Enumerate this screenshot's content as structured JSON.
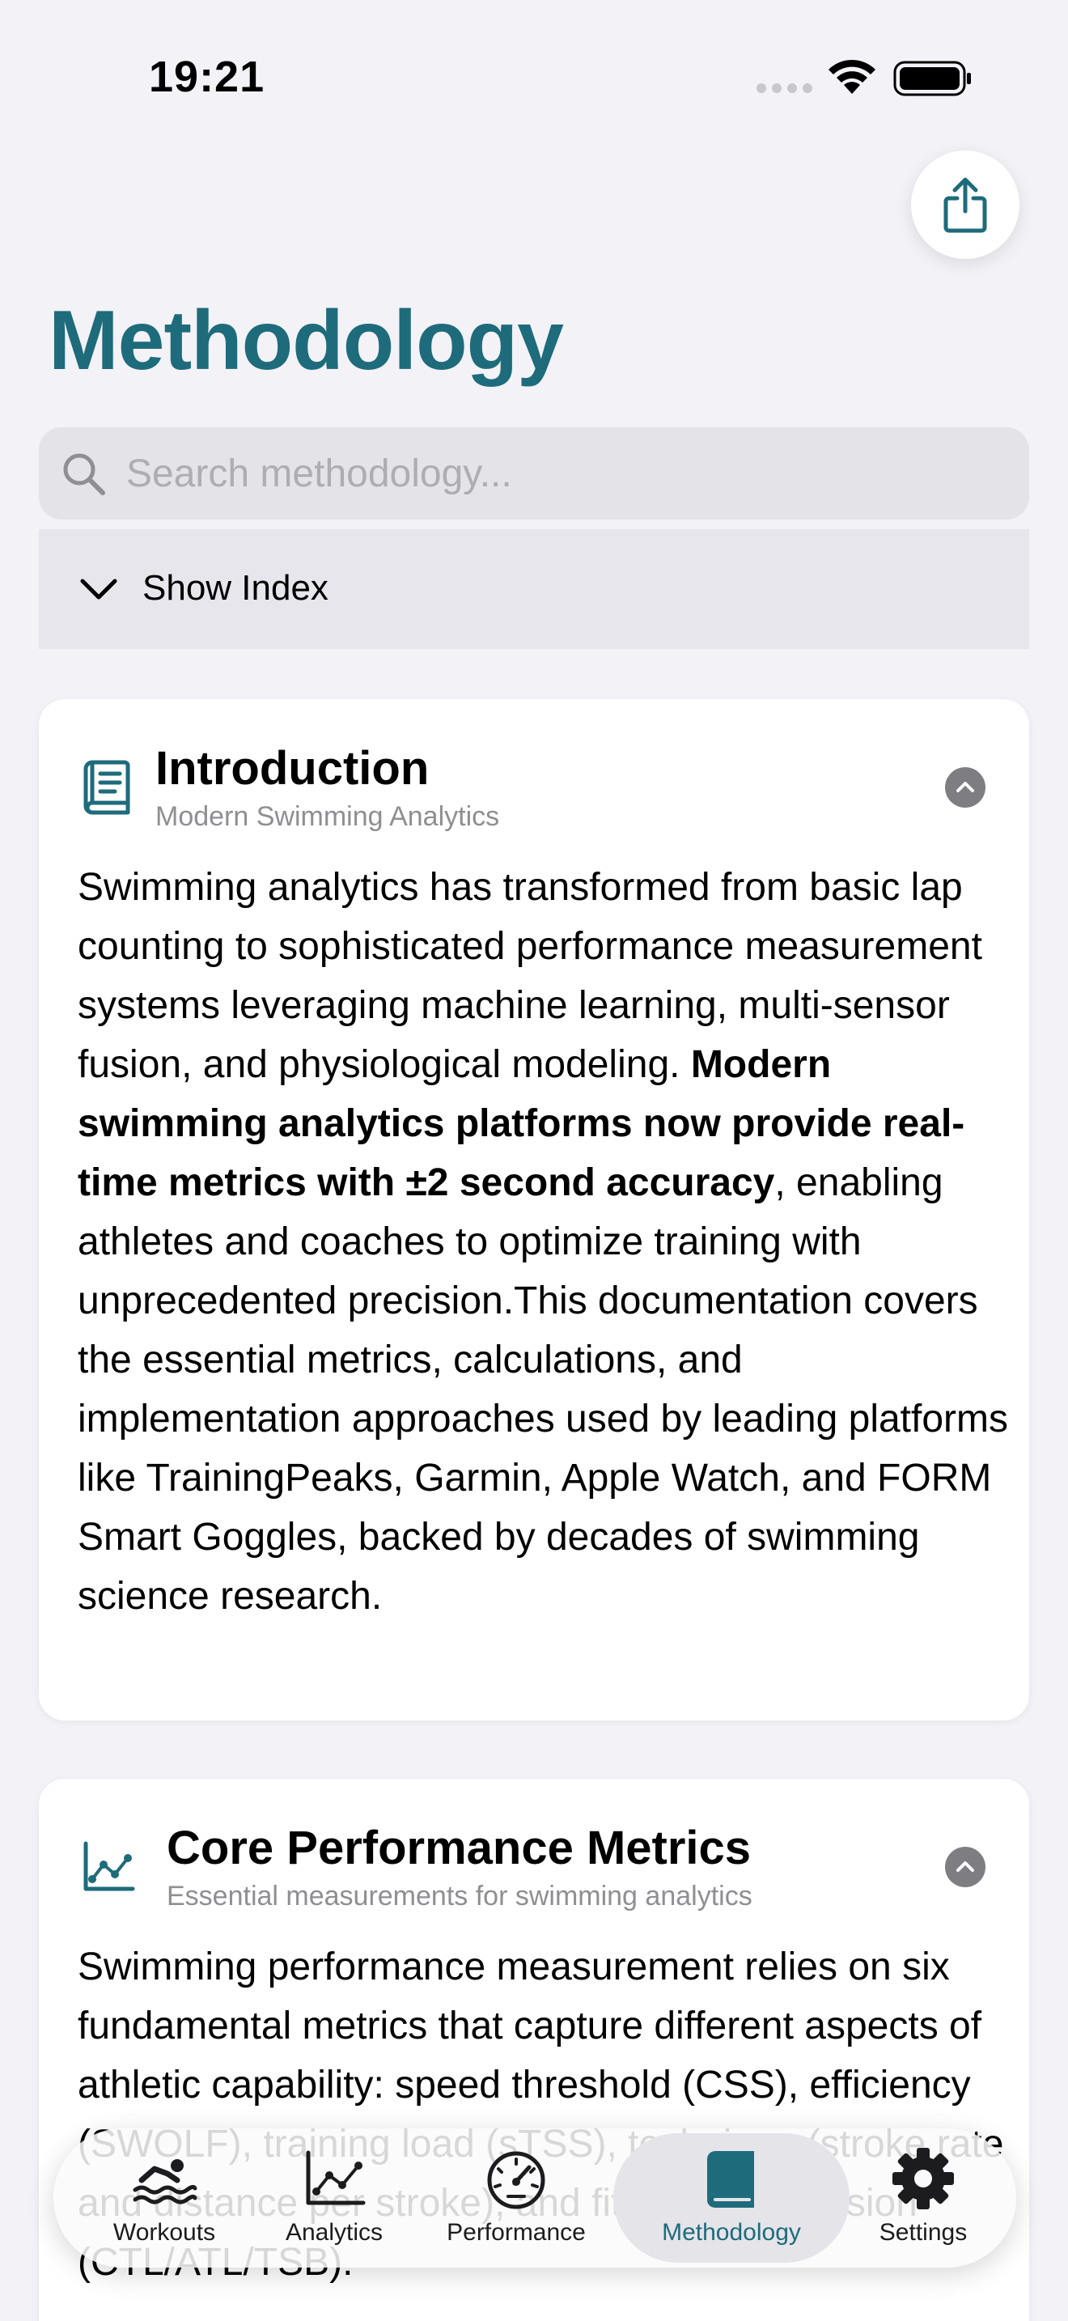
{
  "status_bar": {
    "time": "19:21"
  },
  "header": {
    "title": "Methodology",
    "share_icon": "share-icon"
  },
  "search": {
    "placeholder": "Search methodology...",
    "value": ""
  },
  "index_toggle": {
    "label": "Show Index"
  },
  "sections": [
    {
      "icon": "book-page-icon",
      "title": "Introduction",
      "subtitle": "Modern Swimming Analytics",
      "body_before": "Swimming analytics has transformed from basic lap counting to sophisticated performance measurement systems leveraging machine learning, multi-sensor fusion, and physiological modeling. ",
      "body_bold": "Modern swimming analytics platforms now provide real-time metrics with ±2 second accuracy",
      "body_after": ", enabling athletes and coaches to optimize training with unprecedented precision.This documentation covers the essential metrics, calculations, and implementation approaches used by leading platforms like TrainingPeaks, Garmin, Apple Watch, and FORM Smart Goggles, backed by decades of swimming science research."
    },
    {
      "icon": "line-chart-icon",
      "title": "Core Performance Metrics",
      "subtitle": "Essential measurements for swimming analytics",
      "body": "Swimming performance measurement relies on six fundamental metrics that capture different aspects of athletic capability: speed threshold (CSS), efficiency (SWOLF), training load (sTSS), technique (stroke rate and distance per stroke), and fitness progression (CTL/ATL/TSB)."
    }
  ],
  "tab_bar": {
    "active": "Methodology",
    "accent_color": "#1e6b7b",
    "tabs": [
      {
        "label": "Workouts",
        "icon": "swimmer-icon"
      },
      {
        "label": "Analytics",
        "icon": "chart-icon"
      },
      {
        "label": "Performance",
        "icon": "speedometer-icon"
      },
      {
        "label": "Methodology",
        "icon": "book-icon"
      },
      {
        "label": "Settings",
        "icon": "gear-icon"
      }
    ]
  }
}
